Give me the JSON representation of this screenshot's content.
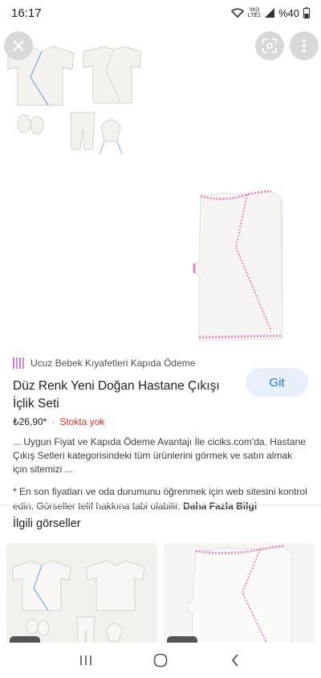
{
  "status_bar": {
    "time": "16:17",
    "lte_top": "Vo))",
    "lte_bottom": "LTE1",
    "battery": "%40"
  },
  "viewer": {
    "close_icon": "close-icon",
    "lens_icon": "lens-icon",
    "more_icon": "more-vert-icon"
  },
  "product": {
    "source": "Ucuz Bebek Kıyafetleri Kapıda Ödeme",
    "title": "Düz Renk Yeni Doğan Hastane Çıkışı İçlik Seti",
    "visit_button": "Git",
    "price": "₺26,90*",
    "separator": "·",
    "stock": "Stokta yok",
    "description": "... Uygun Fiyat ve Kapıda Ödeme Avantajı İle ciciks.com'da. Hastane Çıkış Setleri kategorisindeki tüm ürünlerini görmek ve satın almak için sitemizi ...",
    "disclaimer": "* En son fiyatları ve oda durumunu öğrenmek için web sitesini kontrol edin. Görseller telif hakkına tabi olabilir.",
    "more_info": "Daha Fazla Bilgi"
  },
  "related": {
    "title": "İlgili görseller"
  },
  "colors": {
    "accent": "#1a73e8",
    "stock": "#d93025",
    "pink_trim": "#e88cc0",
    "blue_trim": "#8fb3e0"
  }
}
